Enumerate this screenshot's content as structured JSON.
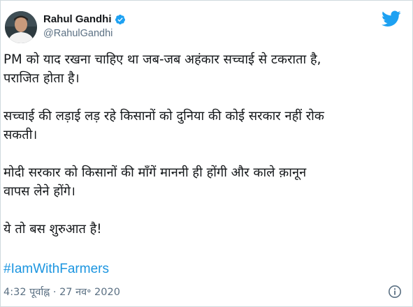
{
  "author": {
    "name": "Rahul Gandhi",
    "handle": "@RahulGandhi",
    "verified_icon": "verified-badge-icon"
  },
  "brand": {
    "icon": "twitter-bird-icon",
    "color": "#1da1f2"
  },
  "tweet": {
    "paragraphs": [
      [
        "PM को याद रखना चाहिए था जब-जब अहंकार सच्चाई से टकराता है,",
        "पराजित होता है।"
      ],
      [
        "सच्चाई की लड़ाई लड़ रहे किसानों को दुनिया की कोई सरकार नहीं रोक",
        "सकती।"
      ],
      [
        "मोदी सरकार को किसानों की माँगें माननी ही होंगी और काले क़ानून",
        "वापस लेने होंगे।"
      ],
      [
        "ये तो बस शुरुआत है!"
      ]
    ],
    "hashtag": "#IamWithFarmers",
    "timestamp": "4:32 पूर्वाह्न · 27 नव॰ 2020"
  },
  "colors": {
    "link": "#1b95e0",
    "secondary_text": "#5b7083",
    "verified": "#1da1f2"
  }
}
